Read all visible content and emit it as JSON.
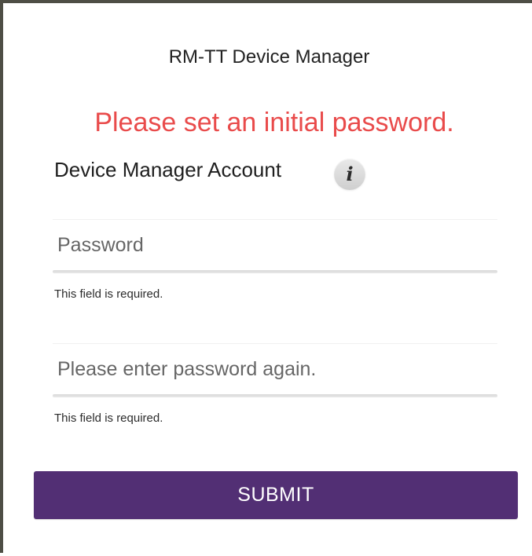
{
  "header": {
    "title": "RM-TT Device Manager"
  },
  "status": {
    "message": "Please set an initial password.",
    "color": "#e94b4b"
  },
  "account": {
    "title": "Device Manager Account",
    "info_icon": "info-icon",
    "info_glyph": "i"
  },
  "fields": {
    "password": {
      "value": "",
      "placeholder": "Password",
      "helper": "This field is required."
    },
    "confirm_password": {
      "value": "",
      "placeholder": "Please enter password again.",
      "helper": "This field is required."
    }
  },
  "actions": {
    "submit_label": "SUBMIT",
    "submit_color": "#522f74"
  },
  "colors": {
    "border": "#4e4e45",
    "background": "#ffffff",
    "text": "#222222"
  }
}
